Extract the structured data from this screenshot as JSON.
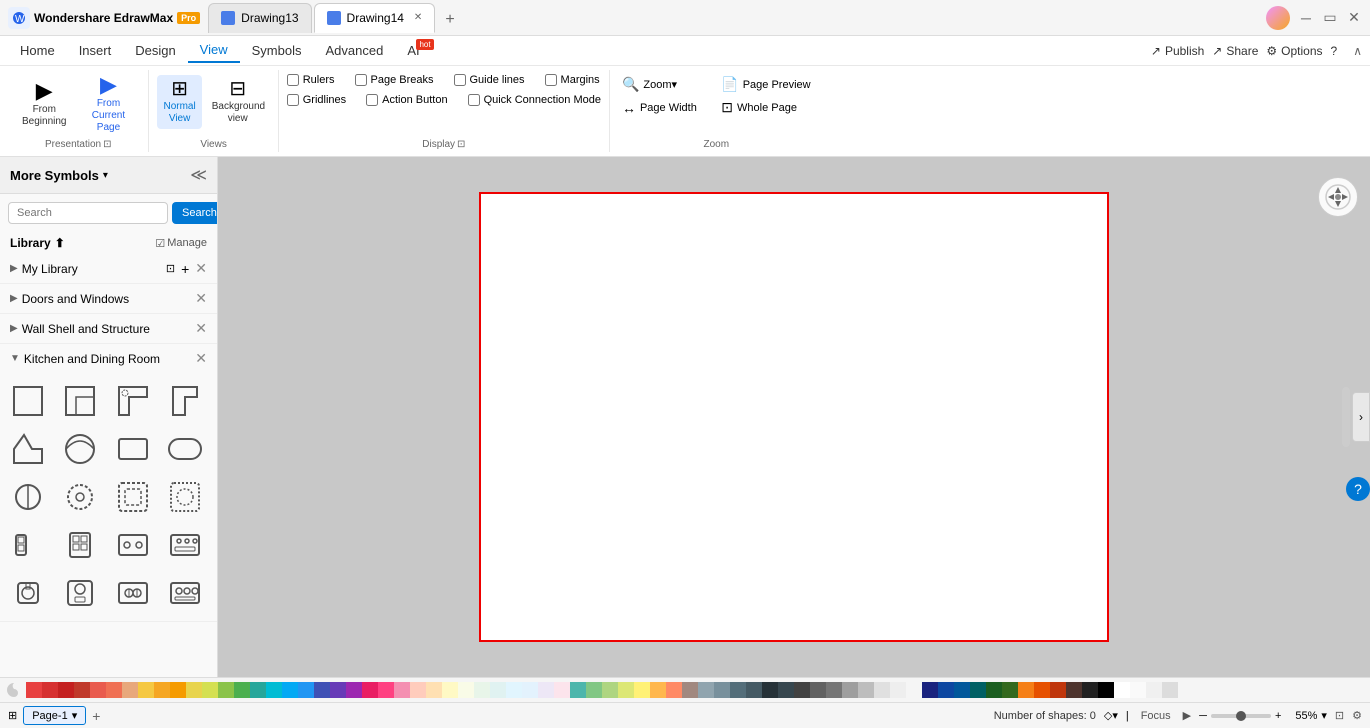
{
  "titleBar": {
    "appName": "Wondershare EdrawMax",
    "proLabel": "Pro",
    "tabs": [
      {
        "id": "drawing13",
        "label": "Drawing13",
        "active": false,
        "closable": true
      },
      {
        "id": "drawing14",
        "label": "Drawing14",
        "active": true,
        "closable": true
      }
    ],
    "addTab": "+",
    "winButtons": {
      "minimize": "─",
      "maximize": "▭",
      "close": "✕"
    }
  },
  "ribbon": {
    "tabs": [
      "Home",
      "Insert",
      "Design",
      "View",
      "Symbols",
      "Advanced",
      "AI"
    ],
    "activeTab": "View",
    "hotTab": "AI",
    "actions": [
      {
        "id": "publish",
        "label": "Publish",
        "icon": "↗"
      },
      {
        "id": "share",
        "label": "Share",
        "icon": "↗"
      },
      {
        "id": "options",
        "label": "Options",
        "icon": "⚙"
      }
    ],
    "groups": {
      "presentation": {
        "label": "Presentation",
        "items": [
          {
            "id": "from-beginning",
            "icon": "▶",
            "label": "From\nBeginning"
          },
          {
            "id": "from-current",
            "icon": "▶",
            "label": "From Current\nPage"
          }
        ]
      },
      "views": {
        "label": "Views",
        "items": [
          {
            "id": "normal-view",
            "icon": "⊞",
            "label": "Normal\nView",
            "active": true
          },
          {
            "id": "background-view",
            "icon": "⊟",
            "label": "Background\nview"
          }
        ]
      },
      "display": {
        "label": "Display",
        "checkboxes": [
          {
            "id": "rulers",
            "label": "Rulers",
            "checked": false
          },
          {
            "id": "page-breaks",
            "label": "Page Breaks",
            "checked": false
          },
          {
            "id": "guide-lines",
            "label": "Guide lines",
            "checked": false
          },
          {
            "id": "margins",
            "label": "Margins",
            "checked": false
          },
          {
            "id": "gridlines",
            "label": "Gridlines",
            "checked": false
          },
          {
            "id": "action-button",
            "label": "Action Button",
            "checked": false
          },
          {
            "id": "quick-connection",
            "label": "Quick Connection Mode",
            "checked": false
          }
        ]
      },
      "zoom": {
        "label": "Zoom",
        "items": [
          {
            "id": "zoom-control",
            "icon": "🔍",
            "label": "Zoom▾"
          },
          {
            "id": "page-preview",
            "icon": "📄",
            "label": "Page Preview"
          },
          {
            "id": "page-width",
            "icon": "↔",
            "label": "Page Width"
          },
          {
            "id": "whole-page",
            "icon": "⊡",
            "label": "Whole Page"
          }
        ]
      }
    }
  },
  "sidebar": {
    "title": "More Symbols",
    "search": {
      "placeholder": "Search",
      "buttonLabel": "Search"
    },
    "library": {
      "label": "Library",
      "manageLabel": "Manage"
    },
    "sections": [
      {
        "id": "my-library",
        "label": "My Library",
        "expanded": false,
        "closable": true
      },
      {
        "id": "doors-windows",
        "label": "Doors and Windows",
        "expanded": false,
        "closable": true
      },
      {
        "id": "wall-shell",
        "label": "Wall Shell and Structure",
        "expanded": false,
        "closable": true
      },
      {
        "id": "kitchen-dining",
        "label": "Kitchen and Dining Room",
        "expanded": true,
        "closable": true
      }
    ]
  },
  "canvas": {
    "pageWidth": 630,
    "pageHeight": 450,
    "backgroundColor": "#ffffff",
    "borderColor": "#e00000"
  },
  "statusBar": {
    "pageName": "Page-1",
    "shapesCount": "Number of shapes: 0",
    "focusLabel": "Focus",
    "zoomLevel": "55%",
    "addPage": "+"
  },
  "colors": [
    "#e84040",
    "#d63030",
    "#c42020",
    "#c0392b",
    "#e95b4e",
    "#f07054",
    "#e8a87c",
    "#f5c842",
    "#f5a623",
    "#f59b00",
    "#e8d44d",
    "#d4e052",
    "#8bc34a",
    "#4caf50",
    "#26a69a",
    "#00bcd4",
    "#03a9f4",
    "#2196f3",
    "#3f51b5",
    "#673ab7",
    "#9c27b0",
    "#e91e63",
    "#ff4081",
    "#f48fb1",
    "#ffccbc",
    "#ffe0b2",
    "#fff9c4",
    "#f9fbe7",
    "#e8f5e9",
    "#e0f2f1",
    "#e1f5fe",
    "#e3f2fd",
    "#ede7f6",
    "#fce4ec",
    "#4db6ac",
    "#81c784",
    "#aed581",
    "#dce775",
    "#fff176",
    "#ffb74d",
    "#ff8a65",
    "#a1887f",
    "#90a4ae",
    "#78909c",
    "#546e7a",
    "#455a64",
    "#263238",
    "#37474f",
    "#424242",
    "#616161",
    "#757575",
    "#9e9e9e",
    "#bdbdbd",
    "#e0e0e0",
    "#eeeeee",
    "#f5f5f5",
    "#1a237e",
    "#0d47a1",
    "#01579b",
    "#006064",
    "#1b5e20",
    "#33691e",
    "#f57f17",
    "#e65100",
    "#bf360c",
    "#4e342e",
    "#212121",
    "#000000",
    "#ffffff",
    "#fafafa",
    "#f0f0f0",
    "#dcdcdc"
  ]
}
